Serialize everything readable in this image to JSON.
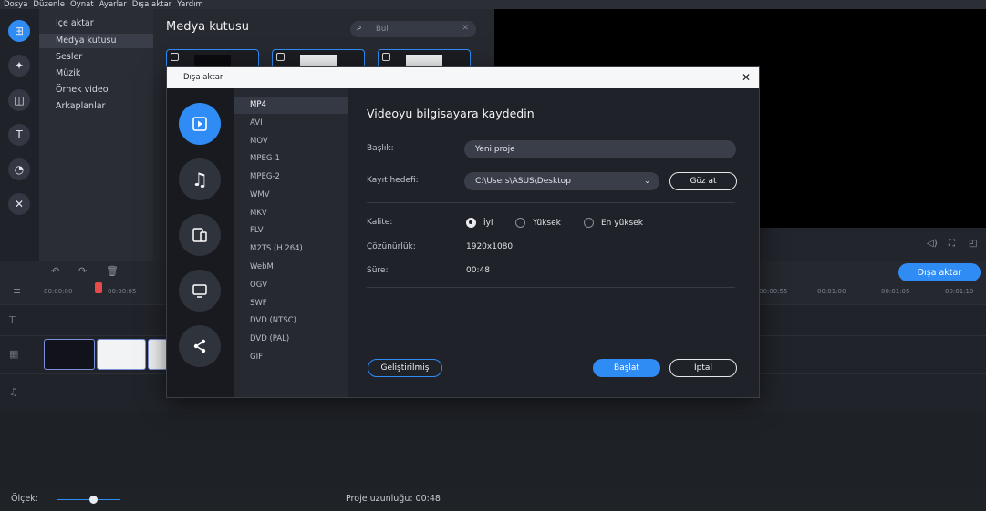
{
  "menu": [
    "Dosya",
    "Düzenle",
    "Oynat",
    "Ayarlar",
    "Dışa aktar",
    "Yardım"
  ],
  "categories": [
    "İçe aktar",
    "Medya kutusu",
    "Sesler",
    "Müzik",
    "Örnek video",
    "Arkaplanlar"
  ],
  "media": {
    "title": "Medya kutusu",
    "search_placeholder": "Bul"
  },
  "timeline": {
    "timecodes_left": [
      "00:00:00",
      "00:00:05"
    ],
    "timecodes_right": [
      "00:00:55",
      "00:01:00",
      "00:01:05",
      "00:01:10"
    ],
    "export_button": "Dışa aktar"
  },
  "status": {
    "scale_label": "Ölçek:",
    "project_length": "Proje uzunluğu: 00:48"
  },
  "dialog": {
    "title": "Dışa aktar",
    "formats": [
      "MP4",
      "AVI",
      "MOV",
      "MPEG-1",
      "MPEG-2",
      "WMV",
      "MKV",
      "FLV",
      "M2TS (H.264)",
      "WebM",
      "OGV",
      "SWF",
      "DVD (NTSC)",
      "DVD (PAL)",
      "GIF"
    ],
    "selected_format": "MP4",
    "heading": "Videoyu bilgisayara kaydedin",
    "title_label": "Başlık:",
    "title_value": "Yeni proje",
    "dest_label": "Kayıt hedefi:",
    "dest_value": "C:\\Users\\ASUS\\Desktop",
    "browse_button": "Göz at",
    "quality_label": "Kalite:",
    "quality_options": [
      "İyi",
      "Yüksek",
      "En yüksek"
    ],
    "quality_selected": "İyi",
    "resolution_label": "Çözünürlük:",
    "resolution_value": "1920x1080",
    "duration_label": "Süre:",
    "duration_value": "00:48",
    "advanced_button": "Geliştirilmiş",
    "start_button": "Başlat",
    "cancel_button": "İptal"
  },
  "colors": {
    "accent": "#2f8cf5",
    "playhead": "#e84a4a"
  }
}
